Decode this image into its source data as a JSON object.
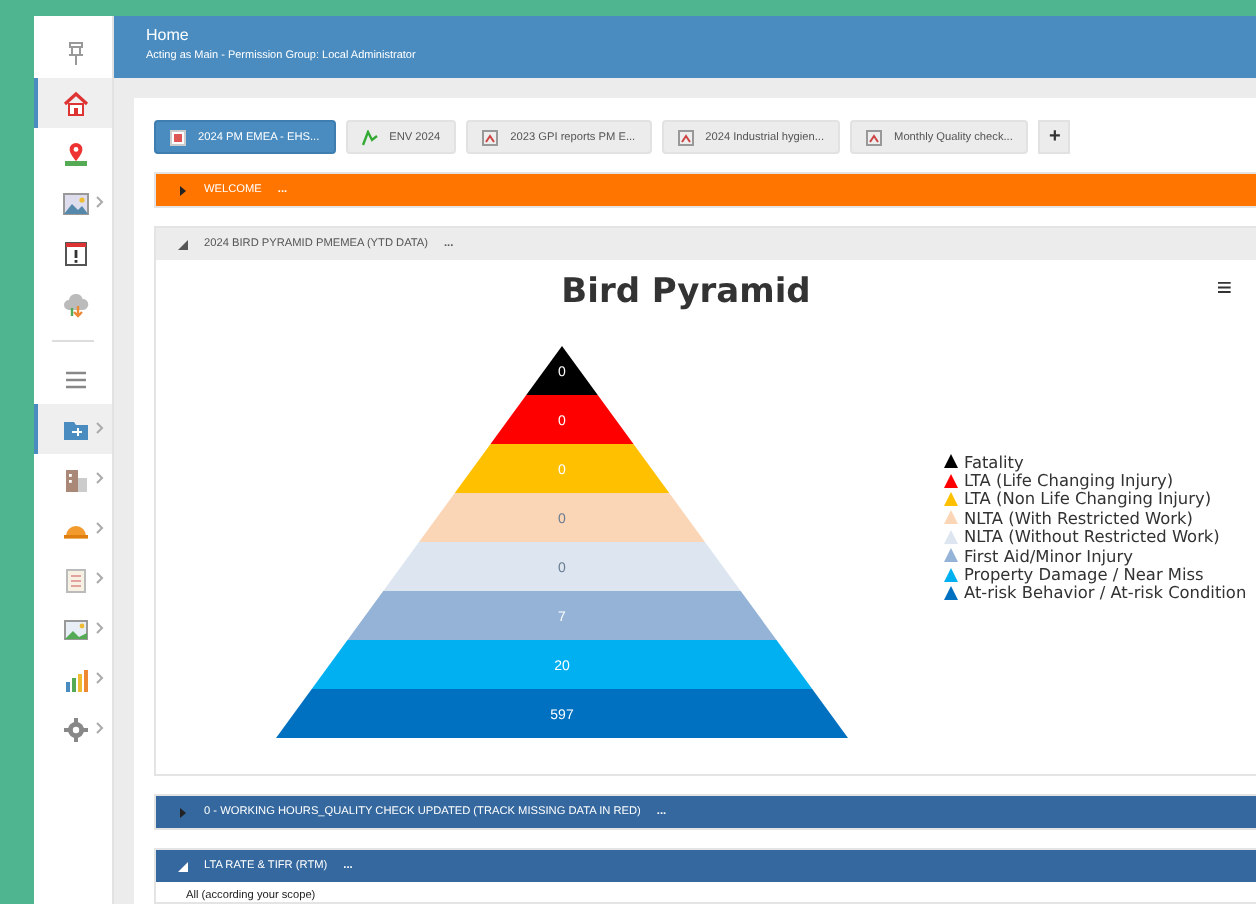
{
  "header": {
    "title": "Home",
    "subtitle": "Acting as Main - Permission Group: Local Administrator"
  },
  "sidebar": {
    "items": [
      {
        "selected": false,
        "has_children": false
      },
      {
        "selected": true,
        "has_children": false
      },
      {
        "selected": false,
        "has_children": false
      },
      {
        "selected": false,
        "has_children": true
      },
      {
        "selected": false,
        "has_children": false
      },
      {
        "selected": false,
        "has_children": false
      },
      {
        "selected": false,
        "has_children": false
      },
      {
        "selected": true,
        "has_children": true
      },
      {
        "selected": false,
        "has_children": true
      },
      {
        "selected": false,
        "has_children": true
      },
      {
        "selected": false,
        "has_children": true
      },
      {
        "selected": false,
        "has_children": true
      },
      {
        "selected": false,
        "has_children": true
      },
      {
        "selected": false,
        "has_children": true
      }
    ]
  },
  "tabs": [
    {
      "label": "2024 PM EMEA - EHS...",
      "selected": true
    },
    {
      "label": "ENV 2024",
      "selected": false
    },
    {
      "label": "2023 GPI reports PM E...",
      "selected": false
    },
    {
      "label": "2024 Industrial hygien...",
      "selected": false
    },
    {
      "label": "Monthly Quality check...",
      "selected": false
    }
  ],
  "add_tab": "+",
  "sections": [
    {
      "title": "WELCOME",
      "color": "#ff7500",
      "expanded": false,
      "menu": "...",
      "kind": "empty"
    },
    {
      "title": "2024 BIRD PYRAMID PMEMEA (YTD DATA)",
      "color": "#ececec",
      "expanded": true,
      "menu": "...",
      "kind": "pyramid",
      "chart": {
        "title": "Bird Pyramid",
        "menu": "≡",
        "levels": [
          {
            "value": "0",
            "label": "Fatality",
            "color": "#000000"
          },
          {
            "value": "0",
            "label": "LTA (Life Changing Injury)",
            "color": "#ff0000"
          },
          {
            "value": "0",
            "label": "LTA (Non Life  Changing Injury)",
            "color": "#ffc000"
          },
          {
            "value": "0",
            "label": "NLTA (With Restricted Work)",
            "color": "#fbd6b6"
          },
          {
            "value": "0",
            "label": "NLTA (Without Restricted Work)",
            "color": "#dde6f0"
          },
          {
            "value": "7",
            "label": "First Aid/Minor Injury",
            "color": "#95b3d7"
          },
          {
            "value": "20",
            "label": "Property Damage / Near Miss",
            "color": "#00b0f0"
          },
          {
            "value": "597",
            "label": "At-risk Behavior / At-risk Condition",
            "color": "#0070c0"
          }
        ]
      }
    },
    {
      "title": "0 - WORKING HOURS_QUALITY CHECK UPDATED (TRACK MISSING DATA IN RED)",
      "color": "#35689e",
      "expanded": false,
      "menu": "...",
      "kind": "empty"
    },
    {
      "title": "LTA RATE & TIFR (RTM)",
      "color": "#35689e",
      "expanded": true,
      "menu": "...",
      "kind": "text",
      "text": "All (according your scope)"
    }
  ]
}
